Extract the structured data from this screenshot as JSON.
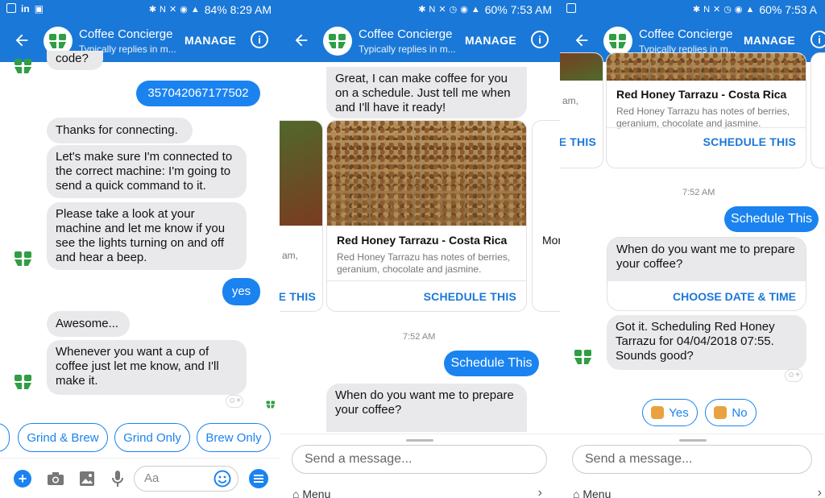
{
  "status": [
    {
      "battery": "84%",
      "time": "8:29 AM"
    },
    {
      "battery": "60%",
      "time": "7:53 AM"
    },
    {
      "battery": "60%",
      "time": "7:53 A"
    }
  ],
  "header": {
    "title": "Coffee Concierge",
    "subtitle": "Typically replies in m...",
    "manage": "MANAGE"
  },
  "panel1": {
    "messages": {
      "top_partial": "code?",
      "user_code": "357042067177502",
      "thanks": "Thanks for connecting.",
      "make_sure": "Let's make sure I'm connected to the correct machine: I'm going to send a quick command to it.",
      "please_look": "Please take a look at your machine and let me know if you see the lights turning on and off and hear a beep.",
      "yes": "yes",
      "awesome": "Awesome...",
      "whenever": "Whenever you want a cup of coffee just let me know, and I'll make it."
    },
    "quick_replies": [
      "Grind & Brew",
      "Grind Only",
      "Brew Only"
    ],
    "input_placeholder": "Aa"
  },
  "panel2": {
    "intro": "Great, I can make coffee for you on a schedule. Just tell me when and I'll have it ready!",
    "card": {
      "title": "Red Honey Tarrazu - Costa Rica",
      "desc": "Red Honey Tarrazu has notes of berries, geranium, chocolate and jasmine.",
      "button": "SCHEDULE THIS"
    },
    "left_partial_desc": "am,",
    "left_partial_btn": "E THIS",
    "right_partial": "Mor",
    "timestamp": "7:52 AM",
    "user_msg": "Schedule This",
    "question": "When do you want me to prepare your coffee?",
    "send_placeholder": "Send a message...",
    "menu": "Menu"
  },
  "panel3": {
    "left_partial_desc": "am,",
    "left_partial_btn": "E THIS",
    "card": {
      "title": "Red Honey Tarrazu - Costa Rica",
      "desc": "Red Honey Tarrazu has notes of berries, geranium, chocolate and jasmine.",
      "button": "SCHEDULE THIS"
    },
    "timestamp": "7:52 AM",
    "user_msg": "Schedule This",
    "question": "When do you want me to prepare your coffee?",
    "choose": "CHOOSE DATE & TIME",
    "confirm": "Got it. Scheduling Red Honey Tarrazu for 04/04/2018 07:55. Sounds good?",
    "yes": "Yes",
    "no": "No",
    "send_placeholder": "Send a message...",
    "menu": "Menu"
  },
  "colors": {
    "brand": "#1a78d8",
    "bubble_user": "#1a83f0",
    "bubble_bot": "#e9e9eb",
    "logo_green": "#2f9e44"
  }
}
